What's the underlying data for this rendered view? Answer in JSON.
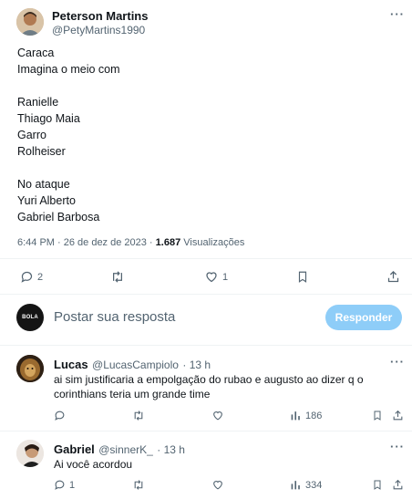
{
  "tweet": {
    "author_name": "Peterson Martins",
    "author_handle": "@PetyMartins1990",
    "lines": [
      "Caraca",
      "Imagina o meio com",
      "",
      "Ranielle",
      "Thiago Maia",
      "Garro",
      "Rolheiser",
      "",
      "No ataque",
      "Yuri Alberto",
      "Gabriel Barbosa"
    ],
    "timestamp": "6:44 PM · 26 de dez de 2023 ·",
    "views_count": "1.687",
    "views_label": "Visualizações",
    "actions": {
      "reply_count": "2",
      "retweet_count": "",
      "like_count": "1"
    }
  },
  "composer": {
    "placeholder": "Postar sua resposta",
    "button_label": "Responder",
    "avatar_text": "BOLA"
  },
  "replies": [
    {
      "author_name": "Lucas",
      "author_handle": "@LucasCampiolo",
      "time": "· 13 h",
      "text_lines": [
        "ai sim justificaria a empolgação do rubao e augusto ao dizer q o",
        "corinthians teria um grande time"
      ],
      "reply_count": "",
      "retweet_count": "",
      "like_count": "",
      "views": "186"
    },
    {
      "author_name": "Gabriel",
      "author_handle": "@sinnerK_",
      "time": "· 13 h",
      "text_lines": [
        "Ai você acordou"
      ],
      "reply_count": "1",
      "retweet_count": "",
      "like_count": "",
      "views": "334"
    }
  ],
  "colors": {
    "accent": "#1d9bf0",
    "button_disabled": "#8ecdf8",
    "secondary_text": "#536471",
    "divider": "#eff3f4"
  }
}
